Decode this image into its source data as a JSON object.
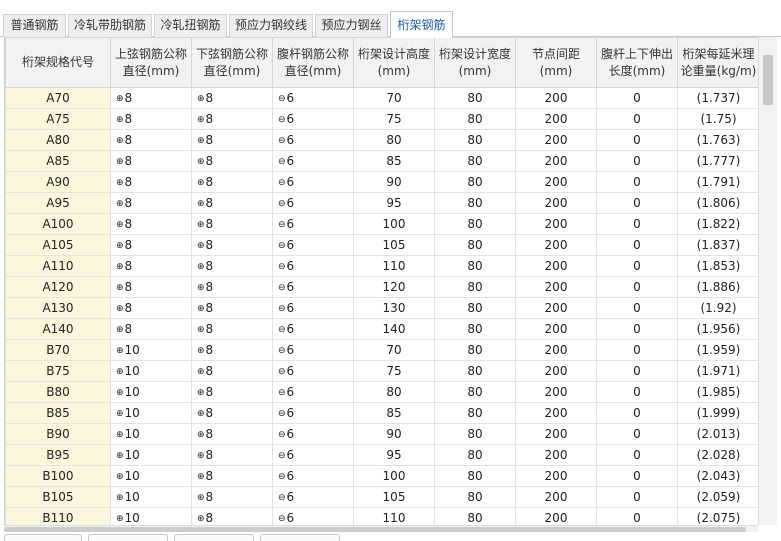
{
  "tabs": [
    {
      "label": "普通钢筋",
      "active": false
    },
    {
      "label": "冷轧带肋钢筋",
      "active": false
    },
    {
      "label": "冷轧扭钢筋",
      "active": false
    },
    {
      "label": "预应力钢绞线",
      "active": false
    },
    {
      "label": "预应力钢丝",
      "active": false
    },
    {
      "label": "桁架钢筋",
      "active": true
    }
  ],
  "table": {
    "columns": [
      "桁架规格代号",
      "上弦钢筋公称直径(mm)",
      "下弦钢筋公称直径(mm)",
      "腹杆钢筋公称直径(mm)",
      "桁架设计高度(mm)",
      "桁架设计宽度(mm)",
      "节点间距(mm)",
      "腹杆上下伸出长度(mm)",
      "桁架每延米理论重量(kg/m)"
    ],
    "rows": [
      [
        "A70",
        "8",
        "8",
        "6",
        "70",
        "80",
        "200",
        "0",
        "(1.737)"
      ],
      [
        "A75",
        "8",
        "8",
        "6",
        "75",
        "80",
        "200",
        "0",
        "(1.75)"
      ],
      [
        "A80",
        "8",
        "8",
        "6",
        "80",
        "80",
        "200",
        "0",
        "(1.763)"
      ],
      [
        "A85",
        "8",
        "8",
        "6",
        "85",
        "80",
        "200",
        "0",
        "(1.777)"
      ],
      [
        "A90",
        "8",
        "8",
        "6",
        "90",
        "80",
        "200",
        "0",
        "(1.791)"
      ],
      [
        "A95",
        "8",
        "8",
        "6",
        "95",
        "80",
        "200",
        "0",
        "(1.806)"
      ],
      [
        "A100",
        "8",
        "8",
        "6",
        "100",
        "80",
        "200",
        "0",
        "(1.822)"
      ],
      [
        "A105",
        "8",
        "8",
        "6",
        "105",
        "80",
        "200",
        "0",
        "(1.837)"
      ],
      [
        "A110",
        "8",
        "8",
        "6",
        "110",
        "80",
        "200",
        "0",
        "(1.853)"
      ],
      [
        "A120",
        "8",
        "8",
        "6",
        "120",
        "80",
        "200",
        "0",
        "(1.886)"
      ],
      [
        "A130",
        "8",
        "8",
        "6",
        "130",
        "80",
        "200",
        "0",
        "(1.92)"
      ],
      [
        "A140",
        "8",
        "8",
        "6",
        "140",
        "80",
        "200",
        "0",
        "(1.956)"
      ],
      [
        "B70",
        "10",
        "8",
        "6",
        "70",
        "80",
        "200",
        "0",
        "(1.959)"
      ],
      [
        "B75",
        "10",
        "8",
        "6",
        "75",
        "80",
        "200",
        "0",
        "(1.971)"
      ],
      [
        "B80",
        "10",
        "8",
        "6",
        "80",
        "80",
        "200",
        "0",
        "(1.985)"
      ],
      [
        "B85",
        "10",
        "8",
        "6",
        "85",
        "80",
        "200",
        "0",
        "(1.999)"
      ],
      [
        "B90",
        "10",
        "8",
        "6",
        "90",
        "80",
        "200",
        "0",
        "(2.013)"
      ],
      [
        "B95",
        "10",
        "8",
        "6",
        "95",
        "80",
        "200",
        "0",
        "(2.028)"
      ],
      [
        "B100",
        "10",
        "8",
        "6",
        "100",
        "80",
        "200",
        "0",
        "(2.043)"
      ],
      [
        "B105",
        "10",
        "8",
        "6",
        "105",
        "80",
        "200",
        "0",
        "(2.059)"
      ],
      [
        "B110",
        "10",
        "8",
        "6",
        "110",
        "80",
        "200",
        "0",
        "(2.075)"
      ]
    ]
  },
  "colors": {
    "accent": "#1e5aa8",
    "code_cell_bg": "#fcf6dc",
    "header_bg": "#f2f2f2"
  },
  "icons": {
    "chord_bar_symbol": "hrb400-bar-symbol-icon",
    "web_bar_symbol": "hpb300-bar-symbol-icon"
  }
}
